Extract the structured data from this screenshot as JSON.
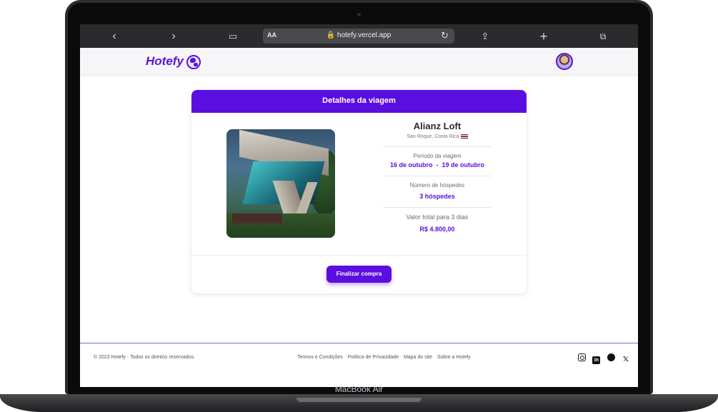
{
  "browser": {
    "url": "hotefy.vercel.app",
    "text_size_label": "AA",
    "device_label": "MacBook Air"
  },
  "header": {
    "logo": "Hotefy"
  },
  "card": {
    "title": "Detalhes da viagem",
    "hotel_name": "Alianz Loft",
    "location": "San Roque, Costa Rica",
    "period_label": "Período da viagem",
    "period_value": "16 de outubro  -  19 de outubro",
    "guests_label": "Número de hóspedes",
    "guests_value": "3 hóspedes",
    "total_label": "Valor total para 3 dias",
    "total_value": "R$ 4.800,00",
    "buy_label": "Finalizar compra"
  },
  "footer": {
    "copyright": "© 2023 Hotefy · Todos os direitos reservados.",
    "links": [
      "Termos e Condições",
      "Política de Privacidade",
      "Mapa do site",
      "Sobre a Hotefy"
    ],
    "social_icons": [
      "instagram-icon",
      "linkedin-icon",
      "github-icon",
      "x-icon"
    ]
  },
  "colors": {
    "accent": "#5b0ee0",
    "safari_bar": "#2b2b2e"
  }
}
